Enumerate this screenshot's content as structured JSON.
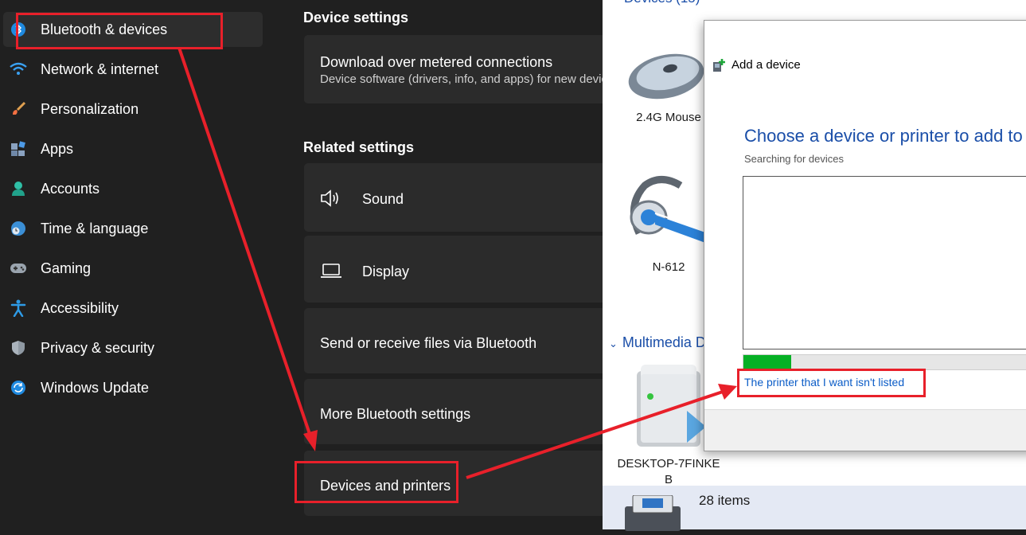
{
  "sidebar": {
    "items": [
      {
        "label": "Bluetooth & devices",
        "icon": "bluetooth-icon",
        "active": true
      },
      {
        "label": "Network & internet",
        "icon": "wifi-icon"
      },
      {
        "label": "Personalization",
        "icon": "brush-icon"
      },
      {
        "label": "Apps",
        "icon": "apps-icon"
      },
      {
        "label": "Accounts",
        "icon": "person-icon"
      },
      {
        "label": "Time & language",
        "icon": "globe-clock-icon"
      },
      {
        "label": "Gaming",
        "icon": "gamepad-icon"
      },
      {
        "label": "Accessibility",
        "icon": "accessibility-icon"
      },
      {
        "label": "Privacy & security",
        "icon": "shield-icon"
      },
      {
        "label": "Windows Update",
        "icon": "update-icon"
      }
    ]
  },
  "main": {
    "device_settings_title": "Device settings",
    "metered": {
      "title": "Download over metered connections",
      "subtitle": "Device software (drivers, info, and apps) for new devices"
    },
    "related_settings_title": "Related settings",
    "related": {
      "sound": "Sound",
      "display": "Display",
      "send_receive": "Send or receive files via Bluetooth",
      "more_bluetooth": "More Bluetooth settings",
      "devices_printers": "Devices and printers"
    }
  },
  "devices_window": {
    "header_partial": "Devices (15)",
    "devices": [
      {
        "name": "2.4G Mouse",
        "icon": "mouse-icon"
      },
      {
        "name": "N-612",
        "icon": "headset-icon"
      },
      {
        "name_line1": "DESKTOP-7FINKE",
        "name_line2": "B",
        "icon": "computer-icon"
      }
    ],
    "multimedia_group": "Multimedia D",
    "item_count": "28 items"
  },
  "dialog": {
    "title": "Add a device",
    "heading": "Choose a device or printer to add to this PC",
    "status": "Searching for devices",
    "progress": 0.15,
    "link": "The printer that I want isn't listed"
  },
  "colors": {
    "highlight": "#e8202a",
    "link": "#0b5cc7",
    "heading": "#1a4ea8",
    "progress": "#06b025"
  }
}
